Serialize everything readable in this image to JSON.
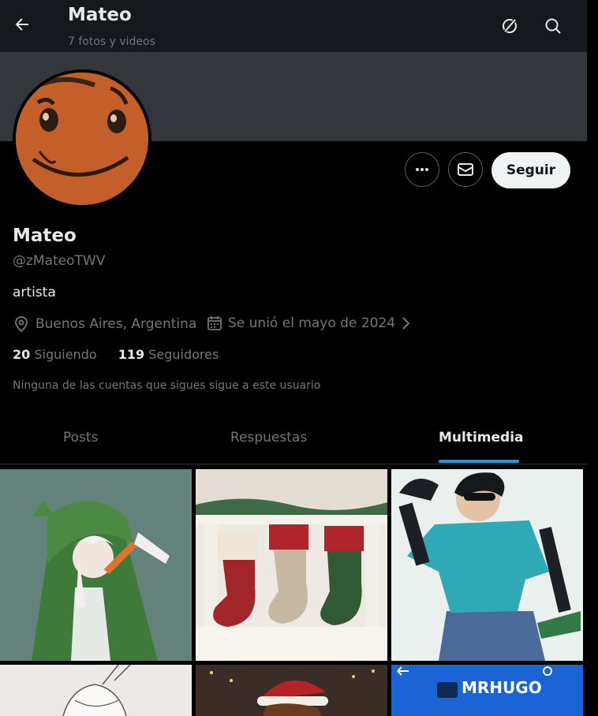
{
  "header": {
    "title": "Mateo",
    "subtitle": "7 fotos y videos"
  },
  "profile": {
    "name": "Mateo",
    "handle": "@zMateoTWV",
    "bio": "artista",
    "location": "Buenos Aires, Argentina",
    "joined": "Se unió el mayo de 2024",
    "following_count": "20",
    "following_label": "Siguiendo",
    "followers_count": "119",
    "followers_label": "Seguidores",
    "followed_by_note": "Ninguna de las cuentas que sigues sigue a este usuario"
  },
  "actions": {
    "follow_label": "Seguir"
  },
  "tabs": [
    {
      "label": "Posts",
      "active": false
    },
    {
      "label": "Respuestas",
      "active": false
    },
    {
      "label": "Multimedia",
      "active": true
    }
  ],
  "media_tiles": {
    "tile6_text": "MRHUGO"
  },
  "colors": {
    "accent": "#1d9bf0",
    "background": "#000000",
    "follow_button_bg": "#eff3f4"
  }
}
